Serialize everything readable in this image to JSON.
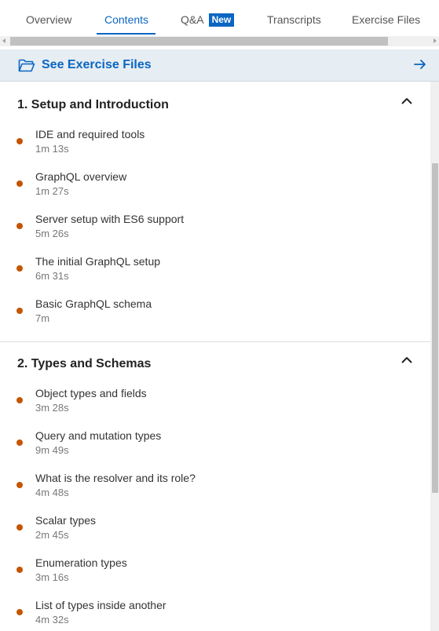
{
  "tabs": [
    {
      "label": "Overview"
    },
    {
      "label": "Contents"
    },
    {
      "label": "Q&A",
      "badge": "New"
    },
    {
      "label": "Transcripts"
    },
    {
      "label": "Exercise Files"
    }
  ],
  "active_tab": "Contents",
  "exercise_files": {
    "label": "See Exercise Files",
    "icon": "folder-icon",
    "arrow_icon": "arrow-right-icon"
  },
  "colors": {
    "accent": "#0a66c2",
    "progress_dot": "#c45500",
    "banner_bg": "#e6edf3"
  },
  "sections": [
    {
      "title": "1. Setup and Introduction",
      "expanded": true,
      "items": [
        {
          "title": "IDE and required tools",
          "duration": "1m 13s"
        },
        {
          "title": "GraphQL overview",
          "duration": "1m 27s"
        },
        {
          "title": "Server setup with ES6 support",
          "duration": "5m 26s"
        },
        {
          "title": "The initial GraphQL setup",
          "duration": "6m 31s"
        },
        {
          "title": "Basic GraphQL schema",
          "duration": "7m"
        }
      ]
    },
    {
      "title": "2. Types and Schemas",
      "expanded": true,
      "items": [
        {
          "title": "Object types and fields",
          "duration": "3m 28s"
        },
        {
          "title": "Query and mutation types",
          "duration": "9m 49s"
        },
        {
          "title": "What is the resolver and its role?",
          "duration": "4m 48s"
        },
        {
          "title": "Scalar types",
          "duration": "2m 45s"
        },
        {
          "title": "Enumeration types",
          "duration": "3m 16s"
        },
        {
          "title": "List of types inside another",
          "duration": "4m 32s"
        }
      ]
    }
  ]
}
